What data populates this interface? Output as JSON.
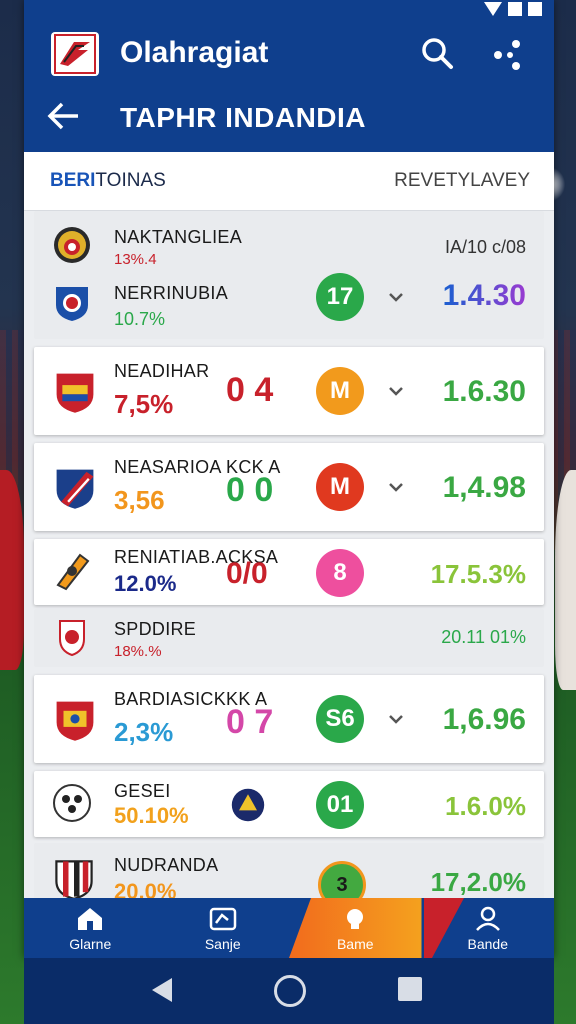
{
  "app": {
    "title": "Olahragiat",
    "subtitle": "TAPHR INDANDIA"
  },
  "header": {
    "left_prefix": "BERI",
    "left_rest": "TOINAS",
    "right": "REVETYLAVEY"
  },
  "matches": [
    {
      "team1": "NAKTANGLIEA",
      "team1_pct": "13%.4",
      "team2": "NERRINUBIA",
      "team2_pct": "10.7%",
      "badge": "17",
      "badge_color": "#2aa84a",
      "odds_top": "IA/10 c/08",
      "odds": "1.4.30"
    },
    {
      "team": "NEADIHAR",
      "pct": "7,5%",
      "score": "0 4",
      "badge": "M",
      "badge_color": "#f29a1c",
      "odds": "1.6.30"
    },
    {
      "team": "NEASARIOA KCK A",
      "pct": "3,56",
      "score": "0 0",
      "badge": "M",
      "badge_color": "#e0391f",
      "odds": "1,4.98"
    },
    {
      "team": "RENIATIAB.ACKSA",
      "pct": "12.0%",
      "score": "0/0",
      "badge": "8",
      "badge_color": "#ee4f9e",
      "odds": "17.5.3%"
    },
    {
      "team": "SPDDIRE",
      "pct": "18%.%",
      "odds": "20.11 01%"
    },
    {
      "team": "BARDIASICKKK A",
      "pct": "2,3%",
      "score": "0 7",
      "badge": "S6",
      "badge_color": "#2aa84a",
      "odds": "1,6.96"
    },
    {
      "team": "GESEI",
      "pct": "50.10%",
      "badge": "01",
      "badge_color": "#2aa84a",
      "odds": "1.6.0%"
    },
    {
      "team": "NUDRANDA",
      "pct": "20.0%",
      "badge": "3",
      "badge_color": "#43a940",
      "odds": "17,2.0%"
    }
  ],
  "nav": [
    {
      "label": "Glarne"
    },
    {
      "label": "Sanje"
    },
    {
      "label": "Bame"
    },
    {
      "label": "Bande"
    }
  ],
  "colors": {
    "primary": "#0f3f8d",
    "accent": "#f26b1d",
    "win": "#2aa84a"
  }
}
